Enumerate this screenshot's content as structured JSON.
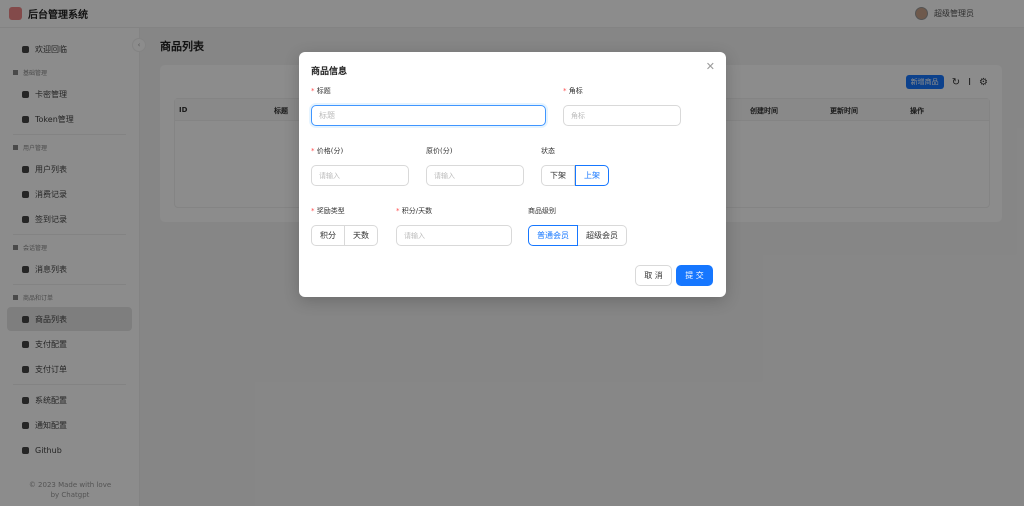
{
  "app": {
    "title": "后台管理系统",
    "user": "超级管理员"
  },
  "sidebar": {
    "items": [
      {
        "type": "item",
        "label": "欢迎回临"
      },
      {
        "type": "group",
        "label": "基础管理"
      },
      {
        "type": "item",
        "label": "卡密管理"
      },
      {
        "type": "item",
        "label": "Token管理"
      },
      {
        "type": "sep"
      },
      {
        "type": "group",
        "label": "用户管理"
      },
      {
        "type": "item",
        "label": "用户列表"
      },
      {
        "type": "item",
        "label": "消费记录"
      },
      {
        "type": "item",
        "label": "签到记录"
      },
      {
        "type": "sep"
      },
      {
        "type": "group",
        "label": "会话管理"
      },
      {
        "type": "item",
        "label": "消息列表"
      },
      {
        "type": "sep"
      },
      {
        "type": "group",
        "label": "商品和订单"
      },
      {
        "type": "item",
        "label": "商品列表",
        "active": true
      },
      {
        "type": "item",
        "label": "支付配置"
      },
      {
        "type": "item",
        "label": "支付订单"
      },
      {
        "type": "sep"
      },
      {
        "type": "item",
        "label": "系统配置"
      },
      {
        "type": "item",
        "label": "通知配置"
      },
      {
        "type": "item",
        "label": "Github"
      }
    ],
    "footer_line1": "© 2023 Made with love",
    "footer_line2": "by Chatgpt"
  },
  "page": {
    "title": "商品列表",
    "new_button": "新增商品",
    "columns": [
      "ID",
      "标题",
      "创建时间",
      "更新时间",
      "操作"
    ]
  },
  "modal": {
    "title": "商品信息",
    "title_label": "标题",
    "title_placeholder": "标题",
    "badge_label": "角标",
    "badge_placeholder": "角标",
    "price_label": "价格(分)",
    "price_placeholder": "请输入",
    "orig_label": "原价(分)",
    "orig_placeholder": "请输入",
    "status_label": "状态",
    "status_options": [
      "下架",
      "上架"
    ],
    "reward_label": "奖励类型",
    "reward_options": [
      "积分",
      "天数"
    ],
    "amount_label": "积分/天数",
    "amount_placeholder": "请输入",
    "level_label": "商品级别",
    "level_options": [
      "普通会员",
      "超级会员"
    ],
    "cancel": "取 消",
    "submit": "提 交"
  },
  "colors": {
    "primary": "#1677ff"
  }
}
